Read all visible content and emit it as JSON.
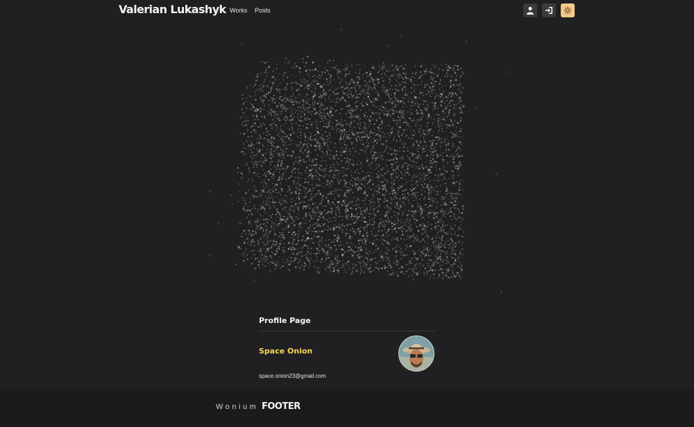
{
  "header": {
    "brand": "Valerian Lukashyk",
    "nav": [
      {
        "label": "Works"
      },
      {
        "label": "Posts"
      }
    ],
    "buttons": [
      {
        "icon": "user-icon"
      },
      {
        "icon": "login-icon"
      },
      {
        "icon": "sun-icon"
      }
    ]
  },
  "profile": {
    "title": "Profile Page",
    "name": "Space Onion",
    "email": "space.onion23@gmail.com"
  },
  "footer": {
    "logo": "Wonium",
    "text": "FOOTER"
  },
  "colors": {
    "background": "#202022",
    "footer": "#1b1b1d",
    "accent_name": "#f5d65a",
    "theme_button": "#f7c98a",
    "icon_button": "#3a3a3c"
  }
}
